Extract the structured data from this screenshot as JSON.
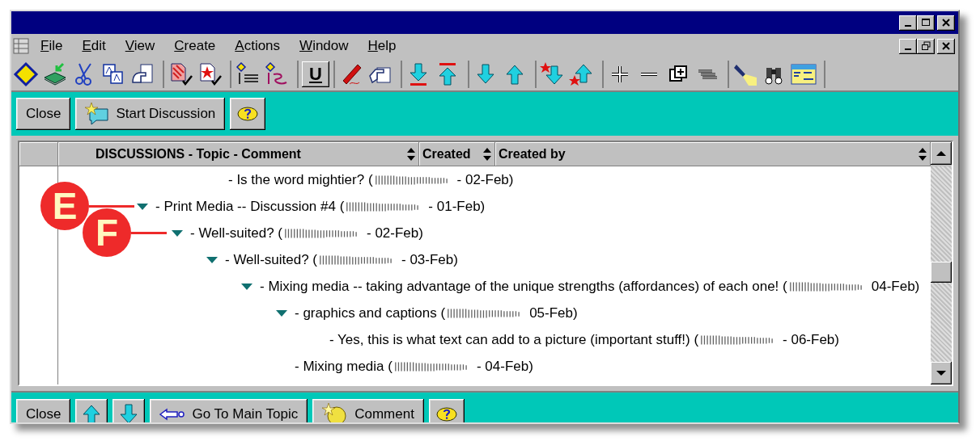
{
  "menu": [
    {
      "label": "File"
    },
    {
      "label": "Edit"
    },
    {
      "label": "View"
    },
    {
      "label": "Create"
    },
    {
      "label": "Actions"
    },
    {
      "label": "Window"
    },
    {
      "label": "Help"
    }
  ],
  "toolbar": {
    "underline_label": "U"
  },
  "action_bar": {
    "buttons": [
      {
        "kind": "text",
        "label": "Close"
      },
      {
        "kind": "start",
        "label": "Start Discussion"
      },
      {
        "kind": "help"
      }
    ]
  },
  "view": {
    "columns": [
      {
        "label": "DISCUSSIONS - Topic - Comment",
        "sortable": true
      },
      {
        "label": "Created",
        "sortable": true
      },
      {
        "label": "Created by",
        "sortable": true
      }
    ],
    "continued_row": {
      "text": "- Is the word mightier? (",
      "date": "- 02-Feb)"
    },
    "tree": [
      {
        "text": "- Print Media -- Discussion #4 (",
        "date": "- 01-Feb)",
        "expanded": true,
        "callout": "E",
        "children": [
          {
            "text": "- Well-suited? (",
            "date": "- 02-Feb)",
            "expanded": true,
            "callout": "F",
            "children": [
              {
                "text": "- Well-suited? (",
                "date": "- 03-Feb)",
                "expanded": true,
                "children": [
                  {
                    "text": "- Mixing media -- taking advantage of the unique strengths (affordances) of each one! (",
                    "date": "04-Feb)",
                    "expanded": true,
                    "children": [
                      {
                        "text": "- graphics and captions (",
                        "date": "05-Feb)",
                        "expanded": true,
                        "children": [
                          {
                            "text": "- Yes, this is what text can add to a picture (important stuff!) (",
                            "date": "- 06-Feb)"
                          }
                        ]
                      },
                      {
                        "text": "- Mixing media (",
                        "date": "- 04-Feb)"
                      }
                    ]
                  }
                ]
              }
            ]
          }
        ]
      }
    ]
  },
  "bottom_bar": {
    "buttons": [
      {
        "kind": "text",
        "label": "Close"
      },
      {
        "kind": "up"
      },
      {
        "kind": "down"
      },
      {
        "kind": "back",
        "label": "Go To Main Topic"
      },
      {
        "kind": "comment",
        "label": "Comment"
      },
      {
        "kind": "help"
      }
    ]
  }
}
